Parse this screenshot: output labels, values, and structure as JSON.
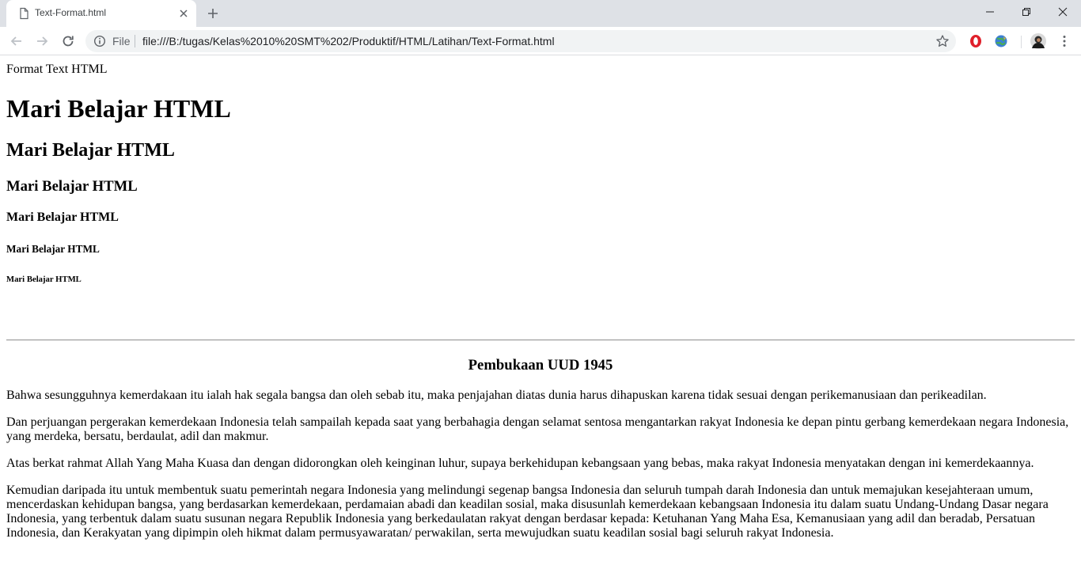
{
  "browser": {
    "tab": {
      "title": "Text-Format.html"
    },
    "address_bar": {
      "scheme_label": "File",
      "url": "file:///B:/tugas/Kelas%2010%20SMT%202/Produktif/HTML/Latihan/Text-Format.html"
    }
  },
  "page": {
    "title_text": "Format Text HTML",
    "headings": [
      "Mari Belajar HTML",
      "Mari Belajar HTML",
      "Mari Belajar HTML",
      "Mari Belajar HTML",
      "Mari Belajar HTML",
      "Mari Belajar HTML"
    ],
    "section_heading": "Pembukaan UUD 1945",
    "paragraphs": [
      "Bahwa sesungguhnya kemerdakaan itu ialah hak segala bangsa dan oleh sebab itu, maka penjajahan diatas dunia harus dihapuskan karena tidak sesuai dengan perikemanusiaan dan perikeadilan.",
      "Dan perjuangan pergerakan kemerdekaan Indonesia telah sampailah kepada saat yang berbahagia dengan selamat sentosa mengantarkan rakyat Indonesia ke depan pintu gerbang kemerdekaan negara Indonesia, yang merdeka, bersatu, berdaulat, adil dan makmur.",
      "Atas berkat rahmat Allah Yang Maha Kuasa dan dengan didorongkan oleh keinginan luhur, supaya berkehidupan kebangsaan yang bebas, maka rakyat Indonesia menyatakan dengan ini kemerdekaannya.",
      "Kemudian daripada itu untuk membentuk suatu pemerintah negara Indonesia yang melindungi segenap bangsa Indonesia dan seluruh tumpah darah Indonesia dan untuk memajukan kesejahteraan umum, mencerdaskan kehidupan bangsa, yang berdasarkan kemerdekaan, perdamaian abadi dan keadilan sosial, maka disusunlah kemerdekaan kebangsaan Indonesia itu dalam suatu Undang-Undang Dasar negara Indonesia, yang terbentuk dalam suatu susunan negara Republik Indonesia yang berkedaulatan rakyat dengan berdasar kepada: Ketuhanan Yang Maha Esa, Kemanusiaan yang adil dan beradab, Persatuan Indonesia, dan Kerakyatan yang dipimpin oleh hikmat dalam permusyawaratan/ perwakilan, serta mewujudkan suatu keadilan sosial bagi seluruh rakyat Indonesia."
    ]
  },
  "icons": {
    "tab_icon": "file-icon",
    "tab_close": "close-icon",
    "new_tab": "plus-icon",
    "back": "arrow-left-icon",
    "forward": "arrow-right-icon",
    "reload": "reload-icon",
    "site_info": "info-icon",
    "bookmark": "star-icon",
    "extension_1": "opera-icon",
    "extension_2": "globe-icon",
    "profile": "avatar-icon",
    "menu": "kebab-menu-icon"
  },
  "colors": {
    "tabstrip_bg": "#dee1e6",
    "omnibox_bg": "#f1f3f4",
    "opera_red": "#e0202b"
  }
}
